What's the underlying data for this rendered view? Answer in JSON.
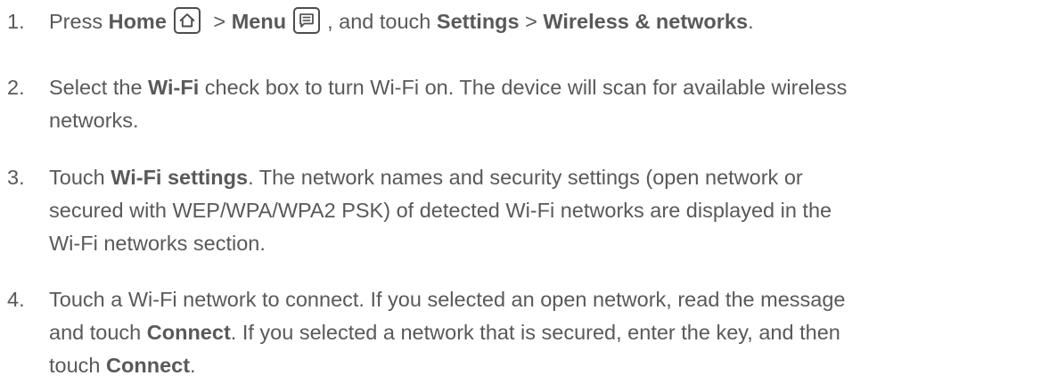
{
  "steps": [
    {
      "number": "1.",
      "parts": {
        "t1": "Press ",
        "b1": "Home",
        "t2": " > ",
        "b2": "Menu",
        "t3": ", and touch ",
        "b3": "Settings",
        "t4": " > ",
        "b4": "Wireless & networks",
        "t5": "."
      },
      "icons": [
        "home-icon",
        "menu-icon"
      ]
    },
    {
      "number": "2.",
      "parts": {
        "t1": "Select the ",
        "b1": "Wi-Fi",
        "t2": " check box to turn Wi-Fi on. The device will scan for available wireless",
        "t3": "networks."
      }
    },
    {
      "number": "3.",
      "parts": {
        "t1": "Touch ",
        "b1": "Wi-Fi settings",
        "t2": ". The network names and security settings (open network or",
        "t3": "secured with WEP/WPA/WPA2 PSK) of detected Wi-Fi networks are displayed in the",
        "t4": "Wi-Fi networks section."
      }
    },
    {
      "number": "4.",
      "parts": {
        "t1": "Touch a Wi-Fi network to connect. If you selected an open network, read the message",
        "t2": "and touch ",
        "b1": "Connect",
        "t3": ". If you selected a network that is secured, enter the key, and then",
        "t4": "touch ",
        "b2": "Connect",
        "t5": "."
      }
    }
  ]
}
